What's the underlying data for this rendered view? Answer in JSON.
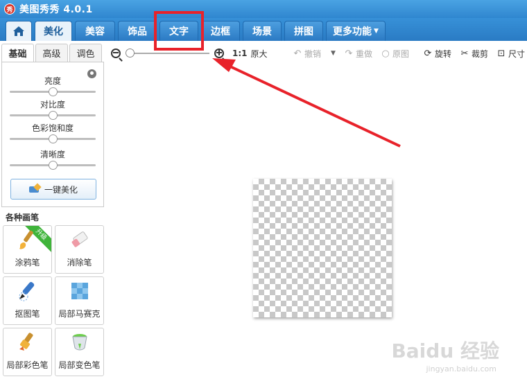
{
  "app": {
    "title": "美图秀秀 4.0.1",
    "logo_text": "秀"
  },
  "tabs": [
    {
      "label": "美化",
      "active": true
    },
    {
      "label": "美容"
    },
    {
      "label": "饰品"
    },
    {
      "label": "文字"
    },
    {
      "label": "边框"
    },
    {
      "label": "场景"
    },
    {
      "label": "拼图"
    },
    {
      "label": "更多功能"
    }
  ],
  "left_panel": {
    "subtabs": [
      "基础",
      "高级",
      "调色"
    ],
    "sliders": [
      {
        "label": "亮度",
        "value": 0.5
      },
      {
        "label": "对比度",
        "value": 0.5
      },
      {
        "label": "色彩饱和度",
        "value": 0.5
      },
      {
        "label": "清晰度",
        "value": 0.5
      }
    ],
    "onekey_label": "一键美化",
    "brush_title": "各种画笔",
    "tools": [
      {
        "label": "涂鸦笔",
        "badge": "升级"
      },
      {
        "label": "消除笔"
      },
      {
        "label": "抠图笔"
      },
      {
        "label": "局部马赛克"
      },
      {
        "label": "局部彩色笔"
      },
      {
        "label": "局部变色笔"
      }
    ]
  },
  "toolbar": {
    "ratio": "1:1",
    "original_size": "原大",
    "undo": "撤销",
    "redo": "重做",
    "original": "原图",
    "rotate": "旋转",
    "crop": "裁剪",
    "size": "尺寸"
  },
  "watermark": {
    "brand": "Baidu 经验",
    "url": "jingyan.baidu.com"
  },
  "colors": {
    "titlebar": "#3a93da",
    "highlight": "#e8222a",
    "arrow": "#e8222a"
  }
}
